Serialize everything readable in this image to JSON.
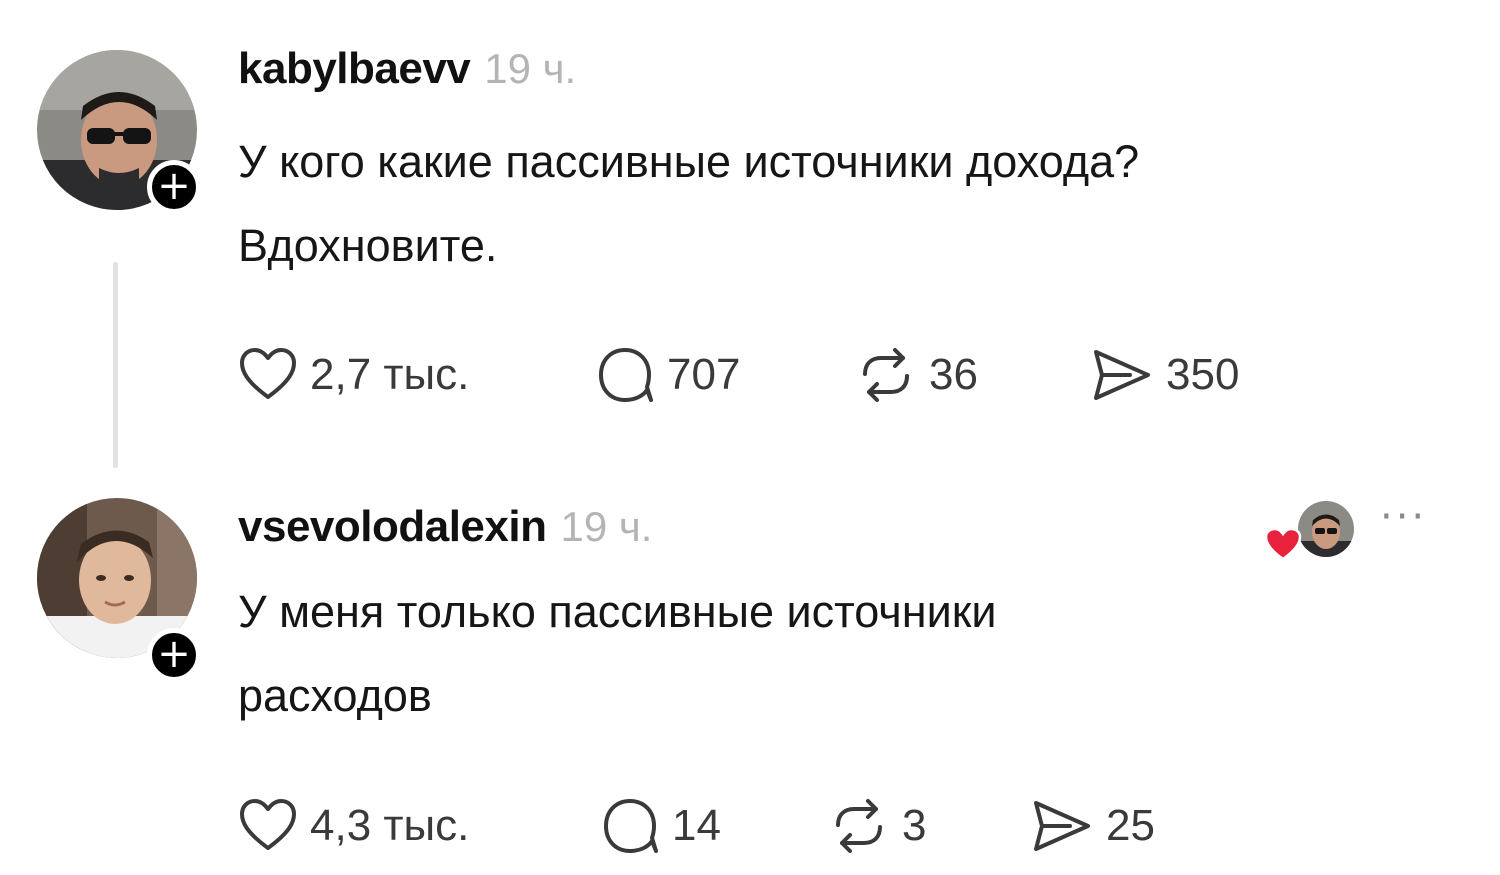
{
  "posts": [
    {
      "username": "kabylbaevv",
      "time": "19 ч.",
      "text_lines": [
        "У кого какие пассивные источники дохода?",
        "Вдохновите."
      ],
      "likes": "2,7 тыс.",
      "comments": "707",
      "reposts": "36",
      "shares": "350"
    },
    {
      "username": "vsevolodalexin",
      "time": "19 ч.",
      "text_lines": [
        "У меня только пассивные источники",
        "расходов"
      ],
      "likes": "4,3 тыс.",
      "comments": "14",
      "reposts": "3",
      "shares": "25"
    }
  ],
  "follow_symbol": "+",
  "more_symbol": "···",
  "icons": {
    "like": "heart-outline-icon",
    "comment": "speech-bubble-icon",
    "repost": "repost-arrows-icon",
    "share": "paper-plane-icon",
    "author_like": "red-heart-icon"
  },
  "colors": {
    "accent_heart": "#e8213c",
    "muted_text": "#b4b4b4",
    "icon_stroke": "#3a3a3a"
  }
}
